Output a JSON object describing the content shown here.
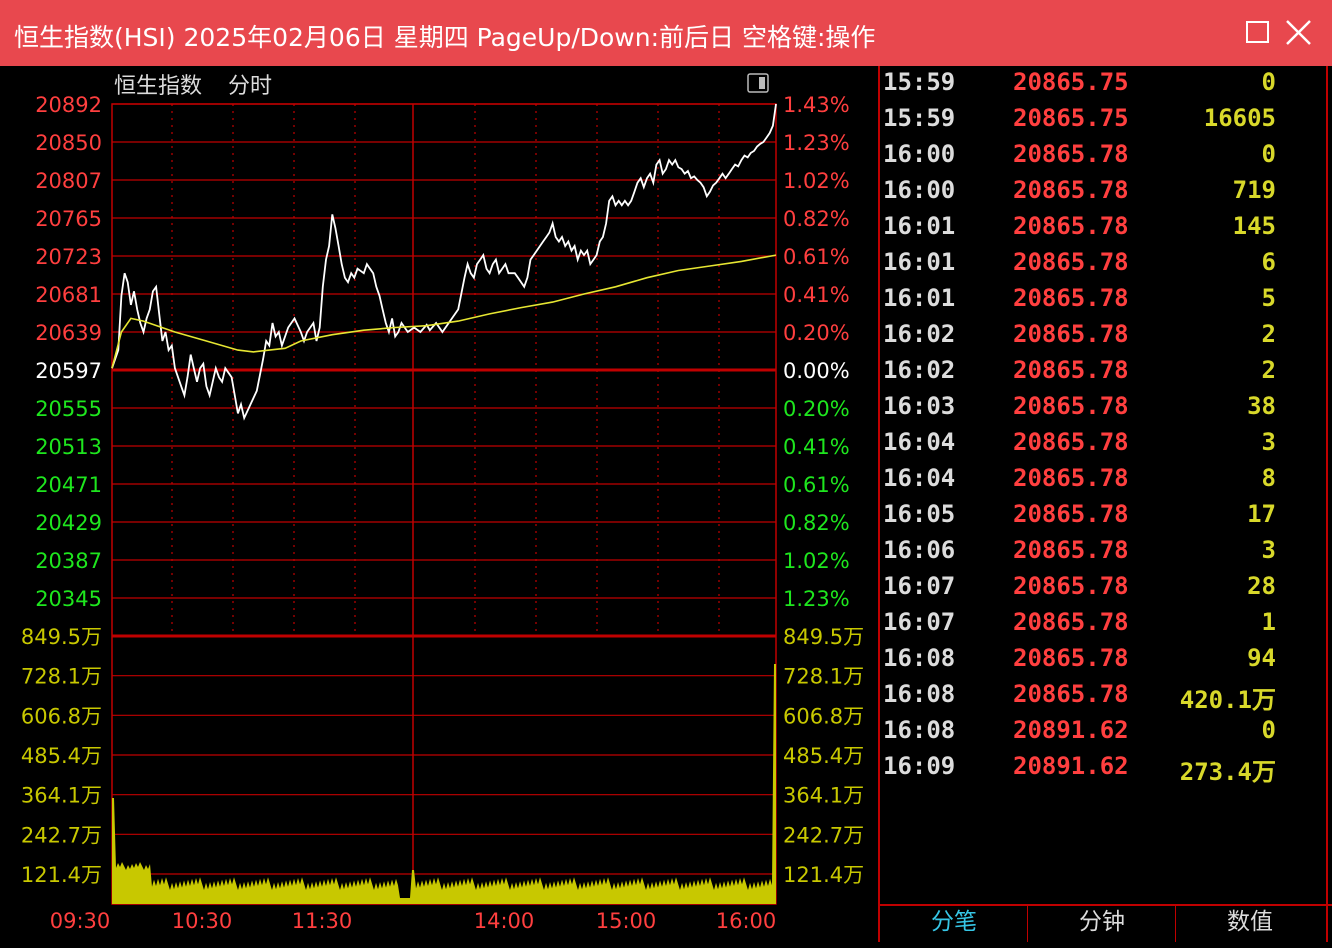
{
  "window": {
    "title": "恒生指数(HSI) 2025年02月06日 星期四 PageUp/Down:前后日 空格键:操作"
  },
  "chart_header": {
    "index_name": "恒生指数",
    "mode": "分时"
  },
  "colors": {
    "titlebar": "#e8484e",
    "grid": "#c00000",
    "up": "#ff3f3f",
    "down": "#1ee61e",
    "price_line": "#ffffff",
    "avg_line": "#e6e632",
    "volume": "#c8c800",
    "active_tab": "#36c6e6"
  },
  "chart_data": {
    "type": "line",
    "prev_close": 20597,
    "price_axis_left": [
      "20892",
      "20850",
      "20807",
      "20765",
      "20723",
      "20681",
      "20639",
      "20597",
      "20555",
      "20513",
      "20471",
      "20429",
      "20387",
      "20345"
    ],
    "pct_axis_right": [
      "1.43%",
      "1.23%",
      "1.02%",
      "0.82%",
      "0.61%",
      "0.41%",
      "0.20%",
      "0.00%",
      "0.20%",
      "0.41%",
      "0.61%",
      "0.82%",
      "1.02%",
      "1.23%"
    ],
    "volume_axis": [
      "849.5万",
      "728.1万",
      "606.8万",
      "485.4万",
      "364.1万",
      "242.7万",
      "121.4万"
    ],
    "time_axis": [
      "09:30",
      "10:30",
      "11:30",
      "14:00",
      "15:00",
      "16:00"
    ],
    "ylim": [
      20324,
      20892
    ],
    "series": [
      {
        "kind": "price",
        "points": [
          [
            0,
            20600
          ],
          [
            2,
            20620
          ],
          [
            3,
            20680
          ],
          [
            4,
            20705
          ],
          [
            5,
            20695
          ],
          [
            6,
            20670
          ],
          [
            7,
            20685
          ],
          [
            8,
            20665
          ],
          [
            9,
            20650
          ],
          [
            10,
            20640
          ],
          [
            11,
            20655
          ],
          [
            12,
            20665
          ],
          [
            13,
            20685
          ],
          [
            14,
            20690
          ],
          [
            15,
            20660
          ],
          [
            16,
            20630
          ],
          [
            17,
            20640
          ],
          [
            18,
            20620
          ],
          [
            19,
            20625
          ],
          [
            20,
            20600
          ],
          [
            22,
            20580
          ],
          [
            23,
            20570
          ],
          [
            24,
            20590
          ],
          [
            25,
            20615
          ],
          [
            26,
            20600
          ],
          [
            27,
            20585
          ],
          [
            28,
            20600
          ],
          [
            29,
            20605
          ],
          [
            30,
            20580
          ],
          [
            31,
            20570
          ],
          [
            32,
            20585
          ],
          [
            33,
            20600
          ],
          [
            34,
            20590
          ],
          [
            35,
            20585
          ],
          [
            36,
            20600
          ],
          [
            38,
            20590
          ],
          [
            40,
            20550
          ],
          [
            41,
            20560
          ],
          [
            42,
            20545
          ],
          [
            44,
            20560
          ],
          [
            46,
            20575
          ],
          [
            48,
            20610
          ],
          [
            49,
            20630
          ],
          [
            50,
            20625
          ],
          [
            51,
            20650
          ],
          [
            52,
            20635
          ],
          [
            53,
            20640
          ],
          [
            54,
            20625
          ],
          [
            56,
            20645
          ],
          [
            58,
            20655
          ],
          [
            60,
            20640
          ],
          [
            61,
            20630
          ],
          [
            62,
            20640
          ],
          [
            64,
            20650
          ],
          [
            65,
            20630
          ],
          [
            66,
            20645
          ],
          [
            67,
            20690
          ],
          [
            68,
            20720
          ],
          [
            69,
            20735
          ],
          [
            70,
            20770
          ],
          [
            71,
            20755
          ],
          [
            72,
            20735
          ],
          [
            73,
            20715
          ],
          [
            74,
            20700
          ],
          [
            75,
            20695
          ],
          [
            76,
            20705
          ],
          [
            77,
            20700
          ],
          [
            78,
            20710
          ],
          [
            80,
            20705
          ],
          [
            81,
            20715
          ],
          [
            82,
            20710
          ],
          [
            83,
            20705
          ],
          [
            84,
            20690
          ],
          [
            85,
            20680
          ],
          [
            86,
            20665
          ],
          [
            87,
            20650
          ],
          [
            88,
            20640
          ],
          [
            89,
            20655
          ],
          [
            90,
            20635
          ],
          [
            91,
            20640
          ],
          [
            92,
            20650
          ],
          [
            94,
            20640
          ],
          [
            96,
            20645
          ],
          [
            98,
            20640
          ],
          [
            100,
            20648
          ],
          [
            101,
            20642
          ],
          [
            103,
            20650
          ],
          [
            105,
            20640
          ],
          [
            107,
            20650
          ],
          [
            110,
            20665
          ],
          [
            112,
            20700
          ],
          [
            113,
            20715
          ],
          [
            114,
            20705
          ],
          [
            115,
            20700
          ],
          [
            116,
            20715
          ],
          [
            117,
            20720
          ],
          [
            118,
            20725
          ],
          [
            119,
            20710
          ],
          [
            120,
            20705
          ],
          [
            121,
            20715
          ],
          [
            122,
            20720
          ],
          [
            123,
            20705
          ],
          [
            124,
            20710
          ],
          [
            125,
            20715
          ],
          [
            126,
            20705
          ],
          [
            128,
            20705
          ],
          [
            129,
            20700
          ],
          [
            130,
            20695
          ],
          [
            131,
            20690
          ],
          [
            132,
            20700
          ],
          [
            133,
            20720
          ],
          [
            134,
            20725
          ],
          [
            135,
            20730
          ],
          [
            136,
            20735
          ],
          [
            137,
            20740
          ],
          [
            138,
            20745
          ],
          [
            139,
            20750
          ],
          [
            140,
            20760
          ],
          [
            141,
            20745
          ],
          [
            142,
            20740
          ],
          [
            143,
            20745
          ],
          [
            144,
            20735
          ],
          [
            145,
            20740
          ],
          [
            146,
            20730
          ],
          [
            147,
            20735
          ],
          [
            148,
            20720
          ],
          [
            149,
            20730
          ],
          [
            150,
            20725
          ],
          [
            151,
            20730
          ],
          [
            152,
            20715
          ],
          [
            153,
            20720
          ],
          [
            154,
            20725
          ],
          [
            155,
            20740
          ],
          [
            156,
            20745
          ],
          [
            157,
            20760
          ],
          [
            158,
            20785
          ],
          [
            159,
            20790
          ],
          [
            160,
            20780
          ],
          [
            161,
            20785
          ],
          [
            162,
            20780
          ],
          [
            163,
            20785
          ],
          [
            164,
            20780
          ],
          [
            165,
            20785
          ],
          [
            166,
            20795
          ],
          [
            167,
            20805
          ],
          [
            168,
            20810
          ],
          [
            169,
            20800
          ],
          [
            170,
            20810
          ],
          [
            171,
            20815
          ],
          [
            172,
            20805
          ],
          [
            173,
            20825
          ],
          [
            174,
            20830
          ],
          [
            175,
            20815
          ],
          [
            176,
            20820
          ],
          [
            177,
            20830
          ],
          [
            178,
            20825
          ],
          [
            179,
            20830
          ],
          [
            180,
            20822
          ],
          [
            181,
            20820
          ],
          [
            182,
            20815
          ],
          [
            183,
            20818
          ],
          [
            184,
            20810
          ],
          [
            185,
            20812
          ],
          [
            186,
            20808
          ],
          [
            187,
            20805
          ],
          [
            188,
            20800
          ],
          [
            189,
            20790
          ],
          [
            190,
            20795
          ],
          [
            191,
            20802
          ],
          [
            192,
            20805
          ],
          [
            193,
            20810
          ],
          [
            194,
            20815
          ],
          [
            195,
            20810
          ],
          [
            196,
            20815
          ],
          [
            197,
            20820
          ],
          [
            198,
            20825
          ],
          [
            199,
            20823
          ],
          [
            200,
            20830
          ],
          [
            201,
            20835
          ],
          [
            202,
            20833
          ],
          [
            203,
            20838
          ],
          [
            204,
            20840
          ],
          [
            205,
            20845
          ],
          [
            206,
            20848
          ],
          [
            207,
            20850
          ],
          [
            208,
            20855
          ],
          [
            209,
            20860
          ],
          [
            210,
            20868
          ],
          [
            211,
            20892
          ]
        ]
      },
      {
        "kind": "average",
        "points": [
          [
            0,
            20600
          ],
          [
            3,
            20640
          ],
          [
            6,
            20655
          ],
          [
            10,
            20652
          ],
          [
            20,
            20640
          ],
          [
            30,
            20630
          ],
          [
            40,
            20620
          ],
          [
            45,
            20618
          ],
          [
            50,
            20620
          ],
          [
            55,
            20622
          ],
          [
            60,
            20630
          ],
          [
            70,
            20637
          ],
          [
            80,
            20642
          ],
          [
            90,
            20645
          ],
          [
            100,
            20647
          ],
          [
            110,
            20652
          ],
          [
            120,
            20660
          ],
          [
            130,
            20667
          ],
          [
            140,
            20673
          ],
          [
            150,
            20682
          ],
          [
            160,
            20690
          ],
          [
            170,
            20700
          ],
          [
            180,
            20708
          ],
          [
            190,
            20713
          ],
          [
            200,
            20718
          ],
          [
            211,
            20725
          ]
        ]
      }
    ]
  },
  "trades": [
    {
      "time": "15:59",
      "price": "20865.75",
      "vol": "0"
    },
    {
      "time": "15:59",
      "price": "20865.75",
      "vol": "16605"
    },
    {
      "time": "16:00",
      "price": "20865.78",
      "vol": "0"
    },
    {
      "time": "16:00",
      "price": "20865.78",
      "vol": "719"
    },
    {
      "time": "16:01",
      "price": "20865.78",
      "vol": "145"
    },
    {
      "time": "16:01",
      "price": "20865.78",
      "vol": "6"
    },
    {
      "time": "16:01",
      "price": "20865.78",
      "vol": "5"
    },
    {
      "time": "16:02",
      "price": "20865.78",
      "vol": "2"
    },
    {
      "time": "16:02",
      "price": "20865.78",
      "vol": "2"
    },
    {
      "time": "16:03",
      "price": "20865.78",
      "vol": "38"
    },
    {
      "time": "16:04",
      "price": "20865.78",
      "vol": "3"
    },
    {
      "time": "16:04",
      "price": "20865.78",
      "vol": "8"
    },
    {
      "time": "16:05",
      "price": "20865.78",
      "vol": "17"
    },
    {
      "time": "16:06",
      "price": "20865.78",
      "vol": "3"
    },
    {
      "time": "16:07",
      "price": "20865.78",
      "vol": "28"
    },
    {
      "time": "16:07",
      "price": "20865.78",
      "vol": "1"
    },
    {
      "time": "16:08",
      "price": "20865.78",
      "vol": "94"
    },
    {
      "time": "16:08",
      "price": "20865.78",
      "vol": "420.1万"
    },
    {
      "time": "16:08",
      "price": "20891.62",
      "vol": "0"
    },
    {
      "time": "16:09",
      "price": "20891.62",
      "vol": "273.4万"
    }
  ],
  "tabs": [
    "分笔",
    "分钟",
    "数值"
  ],
  "active_tab": 0
}
